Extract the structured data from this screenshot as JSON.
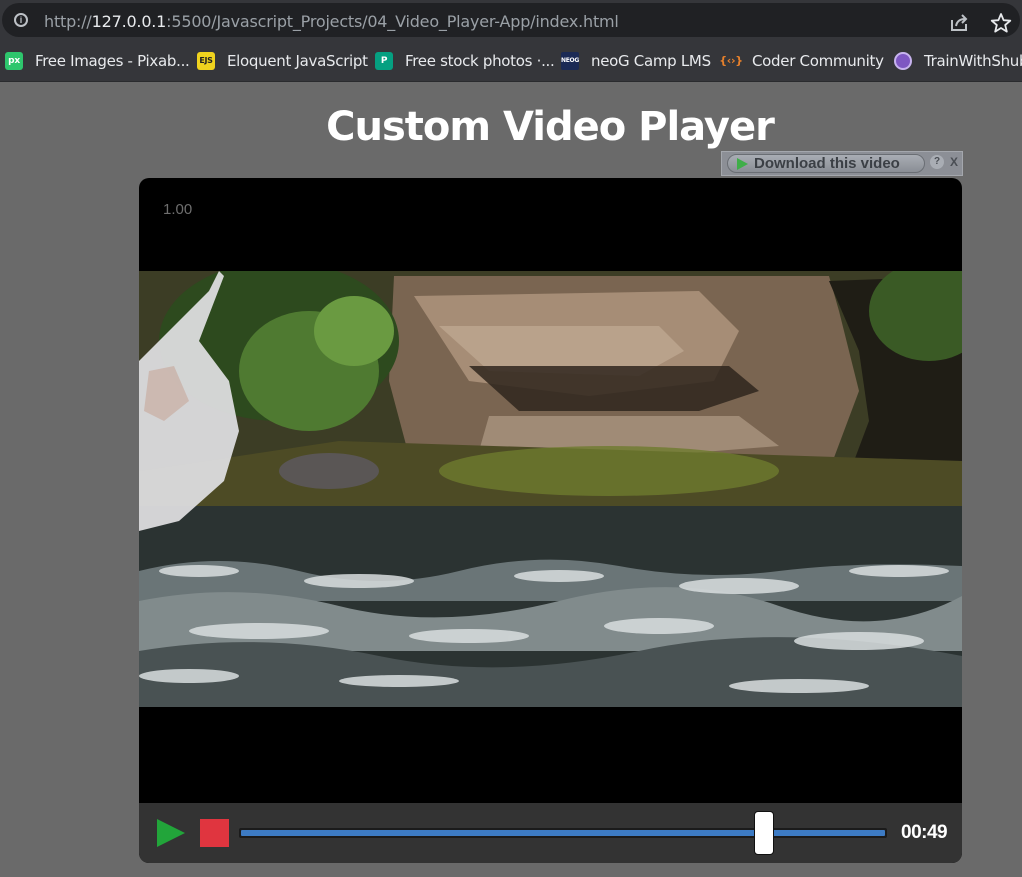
{
  "browser": {
    "url_scheme": "http://",
    "url_host": "127.0.0.1",
    "url_path": ":5500/Javascript_Projects/04_Video_Player-App/index.html",
    "bookmarks": [
      {
        "label": "Free Images - Pixab...",
        "icon": "pixabay-icon",
        "icon_text": "px",
        "color": "#2ec66d"
      },
      {
        "label": "Eloquent JavaScript",
        "icon": "eloquent-js-icon",
        "icon_text": "EJS",
        "color": "#f0d31e"
      },
      {
        "label": "Free stock photos ·...",
        "icon": "pexels-icon",
        "icon_text": "P",
        "color": "#05a081"
      },
      {
        "label": "neoG Camp LMS",
        "icon": "neog-icon",
        "icon_text": "NEOG",
        "color": "#1b2a55"
      },
      {
        "label": "Coder Community",
        "icon": "coder-community-icon",
        "icon_text": "{‹›}",
        "color": "#e8812b"
      },
      {
        "label": "TrainWithShubh",
        "icon": "trainwithshubh-icon",
        "icon_text": "",
        "color": "#7e57c2"
      }
    ]
  },
  "page": {
    "title": "Custom Video Player"
  },
  "download_bar": {
    "label": "Download this video",
    "help": "?",
    "close": "X"
  },
  "player": {
    "speed": "1.00",
    "time": "00:49",
    "progress_fraction": 0.81,
    "colors": {
      "play": "#22a53a",
      "stop": "#e0353f",
      "progress": "#3d7bc4"
    }
  }
}
